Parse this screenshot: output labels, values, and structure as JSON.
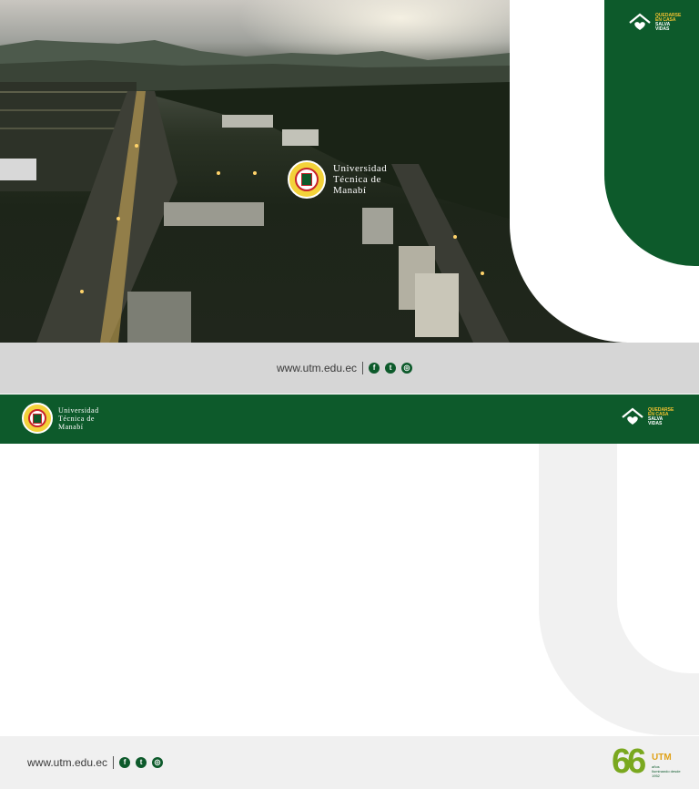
{
  "brand": {
    "university_line1": "Universidad",
    "university_line2": "Técnica de",
    "university_line3": "Manabí"
  },
  "campaign": {
    "line1": "QUEDARSE",
    "line2": "EN CASA",
    "line3": "SALVA",
    "line4": "VIDAS"
  },
  "footer": {
    "website": "www.utm.edu.ec",
    "social": [
      "facebook-icon",
      "twitter-icon",
      "instagram-icon"
    ]
  },
  "anniversary": {
    "number": "66",
    "brand": "UTM",
    "word": "años",
    "tagline": "Iluminando desde 1952"
  },
  "colors": {
    "green": "#0d5a2b",
    "grey_band": "#d6d6d6",
    "light_grey": "#f0f0f0",
    "yellow": "#f2c230"
  }
}
